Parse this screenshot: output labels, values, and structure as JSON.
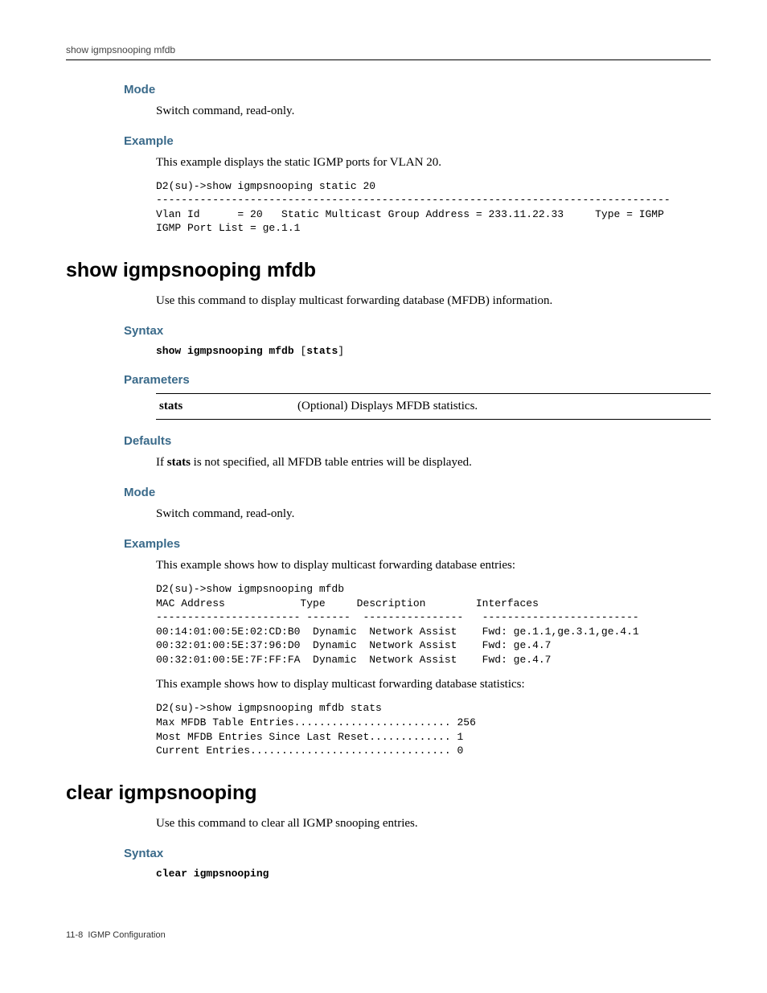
{
  "runningHead": "show igmpsnooping mfdb",
  "section1": {
    "mode": {
      "title": "Mode",
      "text": "Switch command, read-only."
    },
    "example": {
      "title": "Example",
      "intro": "This example displays the static IGMP ports for VLAN 20.",
      "code": "D2(su)->show igmpsnooping static 20\n----------------------------------------------------------------------------------\nVlan Id      = 20   Static Multicast Group Address = 233.11.22.33     Type = IGMP\nIGMP Port List = ge.1.1"
    }
  },
  "section2": {
    "title": "show igmpsnooping mfdb",
    "desc": "Use this command to display multicast forwarding database (MFDB) information.",
    "syntax": {
      "title": "Syntax",
      "cmd_bold": "show igmpsnooping mfdb",
      "cmd_opt_open": " [",
      "cmd_opt_bold": "stats",
      "cmd_opt_close": "]"
    },
    "parameters": {
      "title": "Parameters",
      "rows": [
        {
          "name": "stats",
          "desc": "(Optional) Displays MFDB statistics."
        }
      ]
    },
    "defaults": {
      "title": "Defaults",
      "pre": "If ",
      "bold": "stats",
      "post": " is not specified, all MFDB table entries will be displayed."
    },
    "mode": {
      "title": "Mode",
      "text": "Switch command, read-only."
    },
    "examples": {
      "title": "Examples",
      "intro1": "This example shows how to display multicast forwarding database entries:",
      "code1": "D2(su)->show igmpsnooping mfdb\nMAC Address            Type     Description        Interfaces\n----------------------- -------  ----------------   -------------------------\n00:14:01:00:5E:02:CD:B0  Dynamic  Network Assist    Fwd: ge.1.1,ge.3.1,ge.4.1\n00:32:01:00:5E:37:96:D0  Dynamic  Network Assist    Fwd: ge.4.7\n00:32:01:00:5E:7F:FF:FA  Dynamic  Network Assist    Fwd: ge.4.7",
      "intro2": "This example shows how to display multicast forwarding database statistics:",
      "code2": "D2(su)->show igmpsnooping mfdb stats\nMax MFDB Table Entries......................... 256\nMost MFDB Entries Since Last Reset............. 1\nCurrent Entries................................ 0"
    }
  },
  "section3": {
    "title": "clear igmpsnooping",
    "desc": "Use this command to clear all IGMP snooping entries.",
    "syntax": {
      "title": "Syntax",
      "cmd": "clear igmpsnooping"
    }
  },
  "footer": {
    "pagenum": "11-8",
    "chapter": "IGMP Configuration"
  }
}
